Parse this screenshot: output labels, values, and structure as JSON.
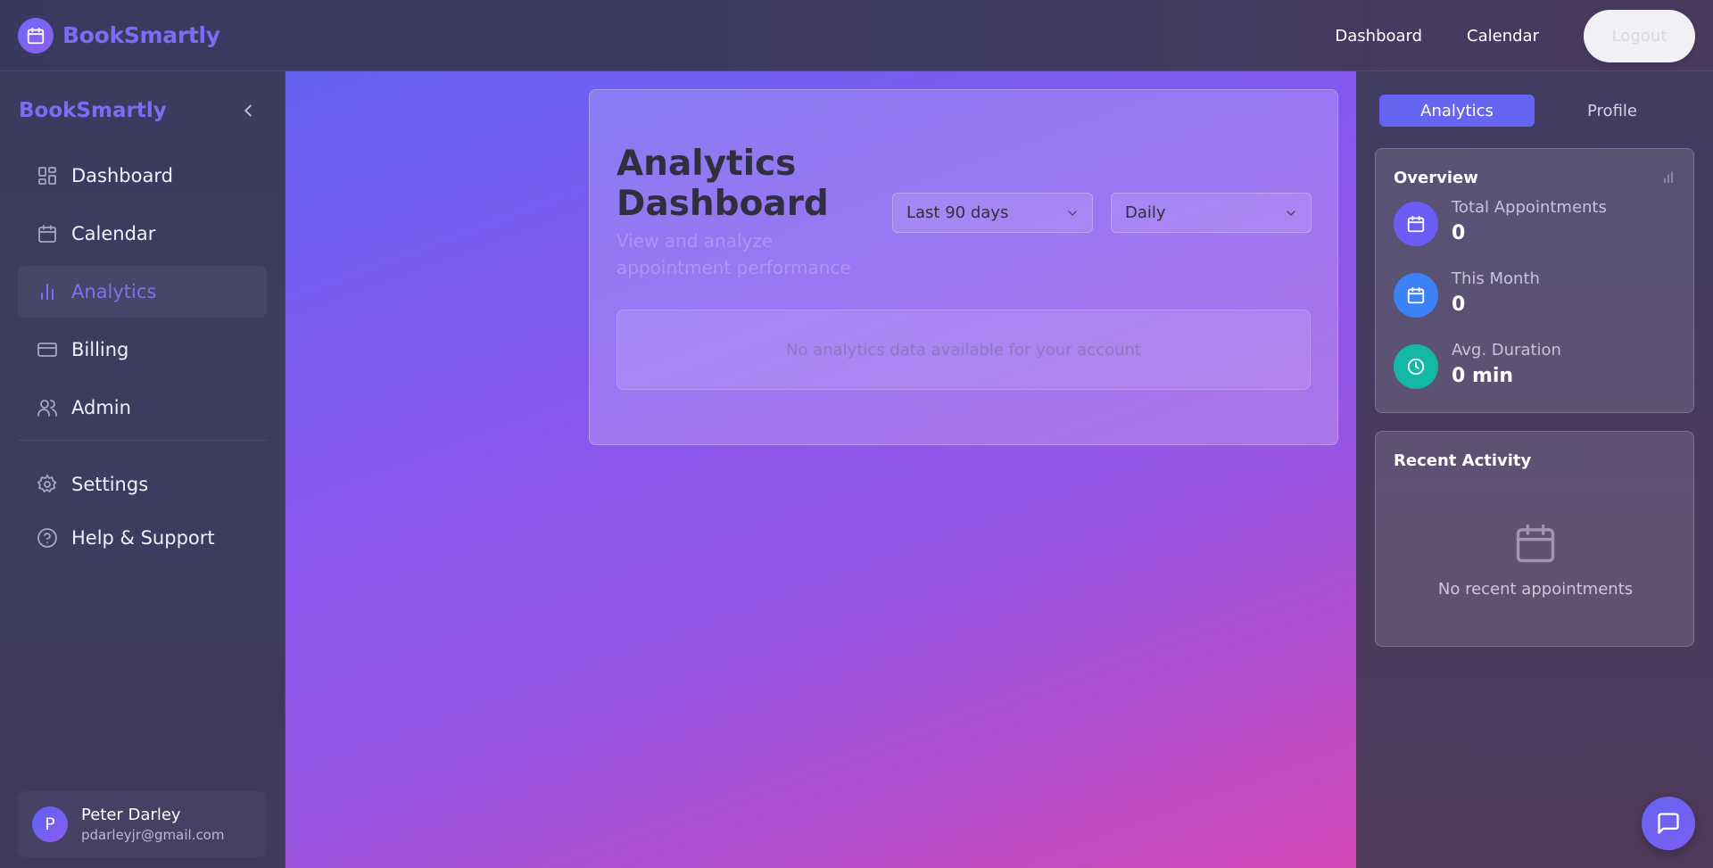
{
  "app": {
    "name": "BookSmartly"
  },
  "topnav": {
    "links": [
      "Dashboard",
      "Calendar"
    ],
    "logout_label": "Logout"
  },
  "sidebar": {
    "brand": "BookSmartly",
    "items": [
      {
        "label": "Dashboard",
        "icon": "dashboard-icon"
      },
      {
        "label": "Calendar",
        "icon": "calendar-icon"
      },
      {
        "label": "Analytics",
        "icon": "analytics-icon",
        "active": true
      },
      {
        "label": "Billing",
        "icon": "credit-card-icon"
      },
      {
        "label": "Admin",
        "icon": "users-icon"
      }
    ],
    "secondary_items": [
      {
        "label": "Settings",
        "icon": "gear-icon"
      },
      {
        "label": "Help & Support",
        "icon": "help-icon"
      }
    ],
    "user": {
      "initial": "P",
      "name": "Peter Darley",
      "email": "pdarleyjr@gmail.com"
    }
  },
  "main": {
    "title": "Analytics Dashboard",
    "subtitle": "View and analyze appointment performance",
    "range_select": {
      "value": "Last 90 days"
    },
    "interval_select": {
      "value": "Daily"
    },
    "empty_message": "No analytics data available for your account"
  },
  "right_panel": {
    "tabs": [
      {
        "label": "Analytics",
        "active": true
      },
      {
        "label": "Profile"
      }
    ],
    "overview": {
      "title": "Overview",
      "stats": [
        {
          "label": "Total Appointments",
          "value": "0",
          "icon": "calendar-icon",
          "color": "#6a5cf5"
        },
        {
          "label": "This Month",
          "value": "0",
          "icon": "calendar-icon",
          "color": "#3b82f6"
        },
        {
          "label": "Avg. Duration",
          "value": "0 min",
          "icon": "clock-icon",
          "color": "#14b8a6"
        }
      ]
    },
    "recent_activity": {
      "title": "Recent Activity",
      "empty_message": "No recent appointments"
    }
  },
  "colors": {
    "brand": "#7a6df3",
    "accent": "#6665f1",
    "main_gradient_start": "#6462f1",
    "main_gradient_end": "#d448b8"
  }
}
